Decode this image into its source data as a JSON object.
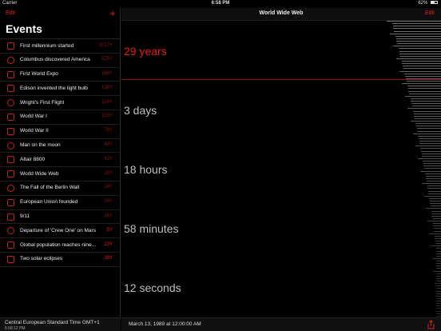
{
  "status_bar": {
    "carrier": "Carrier",
    "time": "6:58 PM",
    "battery": "62%"
  },
  "sidebar": {
    "edit_label": "Edit",
    "add_icon": "plus-icon",
    "title": "Events",
    "events": [
      {
        "name": "First millennium started",
        "value": "1017Y",
        "icon": "calendar-icon",
        "bright": false
      },
      {
        "name": "Columbus discovered America",
        "value": "525Y",
        "icon": "ship-icon",
        "bright": false
      },
      {
        "name": "First World Expo",
        "value": "166Y",
        "icon": "expo-icon",
        "bright": false
      },
      {
        "name": "Edison invented the light bulb",
        "value": "138Y",
        "icon": "lightbulb-icon",
        "bright": false
      },
      {
        "name": "Wright's First Flight",
        "value": "114Y",
        "icon": "plane-icon",
        "bright": false
      },
      {
        "name": "World War I",
        "value": "103Y",
        "icon": "rifle-icon",
        "bright": false
      },
      {
        "name": "World War II",
        "value": "78Y",
        "icon": "gun-icon",
        "bright": false
      },
      {
        "name": "Man on the moon",
        "value": "48Y",
        "icon": "moon-icon",
        "bright": false
      },
      {
        "name": "Altair 8800",
        "value": "42Y",
        "icon": "computer-icon",
        "bright": false
      },
      {
        "name": "World Wide Web",
        "value": "28Y",
        "icon": "globe-icon",
        "bright": false
      },
      {
        "name": "The Fall of the Berlin Wall",
        "value": "28Y",
        "icon": "wall-icon",
        "bright": false
      },
      {
        "name": "European Union founded",
        "value": "24Y",
        "icon": "eu-icon",
        "bright": false
      },
      {
        "name": "9/11",
        "value": "16Y",
        "icon": "towers-icon",
        "bright": false
      },
      {
        "name": "Departure of 'Crew One' on Mars",
        "value": "5Y",
        "icon": "rocket-icon",
        "bright": true
      },
      {
        "name": "Global population reaches nine...",
        "value": "23Y",
        "icon": "population-icon",
        "bright": true
      },
      {
        "name": "Two solar eclipses",
        "value": "38Y",
        "icon": "eclipse-icon",
        "bright": true
      }
    ],
    "footer": {
      "timezone": "Central European Standard Time GMT+1",
      "time": "6:58:12 PM"
    }
  },
  "main": {
    "title": "World Wide Web",
    "edit_label": "Edit",
    "units": [
      "29 years",
      "3 days",
      "18 hours",
      "58 minutes",
      "12 seconds"
    ],
    "date_text": "March 13, 1989 at 12:00:00 AM",
    "share_icon": "share-icon",
    "colors": {
      "accent": "#e0201a",
      "dim_accent": "#8a1713"
    }
  }
}
